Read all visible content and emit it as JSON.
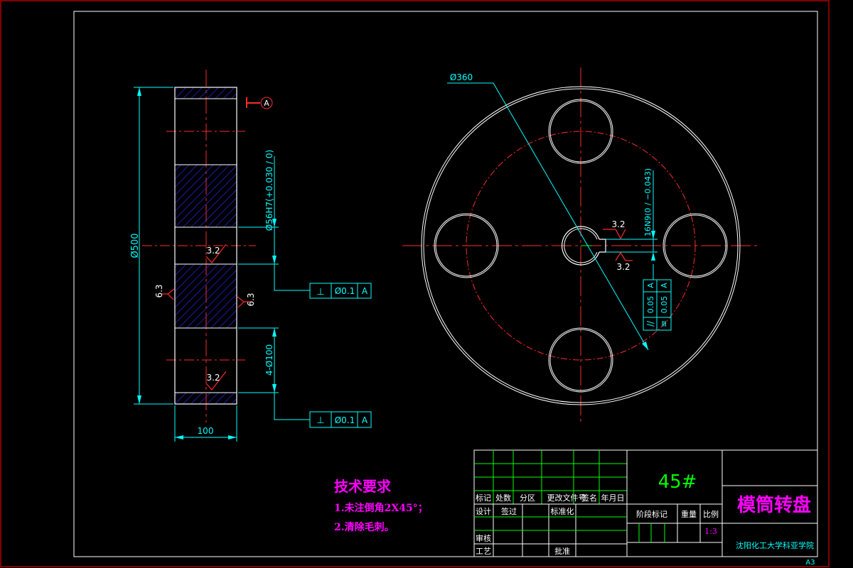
{
  "colors": {
    "background": "#000000",
    "border": "#ffffff",
    "outer_frame": "#ff0000",
    "outline": "#ffffff",
    "center_line": "#ff2a2a",
    "dimension": "#00ffff",
    "hatch": "#2a2aff",
    "title_grid": "#00ff00",
    "tech_text": "#ff00ff",
    "material_text": "#00ff00",
    "title_name": "#ff00ff",
    "school_text": "#00ffff"
  },
  "side_view": {
    "datum_label": "A",
    "dim_overall_diameter": "Ø500",
    "dim_bore": "Ø56H7(+0.030 / 0)",
    "dim_holes": "4-Ø100",
    "dim_width": "100",
    "roughness_top": "3.2",
    "roughness_bottom": "3.2",
    "roughness_left": "6.3",
    "roughness_right": "6.3",
    "tolerance_frames": [
      {
        "symbol": "⊥",
        "value": "Ø0.1",
        "datum": "A"
      },
      {
        "symbol": "⊥",
        "value": "Ø0.1",
        "datum": "A"
      }
    ]
  },
  "front_view": {
    "dim_pitch_circle": "Ø360",
    "dim_keyway": "16N9(0 / −0.043)",
    "roughness_keyway_top": "3.2",
    "roughness_keyway_bottom": "3.2",
    "tolerance_frames": [
      {
        "symbol": "//",
        "value": "0.05",
        "datum": "A"
      },
      {
        "symbol": "≡",
        "value": "0.05",
        "datum": "A"
      }
    ]
  },
  "tech_requirements": {
    "title": "技术要求",
    "items": [
      "1.未注倒角2X45°；",
      "2.清除毛刺。"
    ]
  },
  "title_block": {
    "material": "45#",
    "part_name": "模筒转盘",
    "school": "沈阳化工大学科亚学院",
    "sheet_size": "A3",
    "scale_label": "比例",
    "scale_value": "1:3",
    "stage_label": "阶段标记",
    "weight_label": "重量",
    "row_headers": [
      "标记",
      "处数",
      "分区",
      "更改文件号",
      "签名",
      "年月日"
    ],
    "design_label": "设计",
    "sign_label": "签过",
    "standard_label": "标准化",
    "review_label": "审核",
    "process_label": "工艺",
    "approve_label": "批准"
  }
}
